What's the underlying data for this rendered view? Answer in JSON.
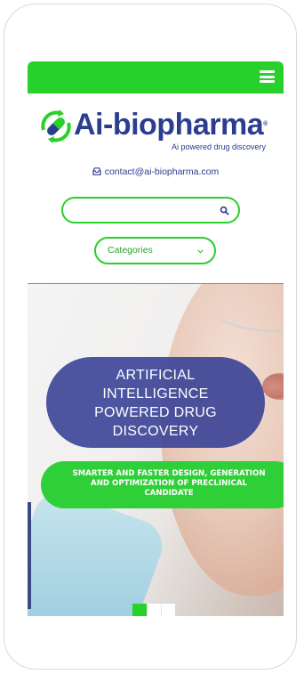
{
  "header": {
    "menu_icon": "hamburger-menu-icon",
    "accent_color": "#27d02a"
  },
  "brand": {
    "name_part1": "Ai-",
    "name_part2": "biopharma",
    "registered_mark": "®",
    "tagline": "Ai powered drug discovery",
    "brand_color": "#2b3d8f"
  },
  "contact": {
    "email": "contact@ai-biopharma.com",
    "icon": "email-tray-icon"
  },
  "search": {
    "value": "",
    "placeholder": "",
    "icon": "search-icon"
  },
  "categories": {
    "selected": "Categories",
    "icon": "chevron-down-icon"
  },
  "hero": {
    "title": "ARTIFICIAL\nINTELLIGENCE\nPOWERED DRUG\nDISCOVERY",
    "subtitle": "SMARTER AND FASTER DESIGN, GENERATION\nAND OPTIMIZATION OF PRECLINICAL\nCANDIDATE",
    "slides": 3,
    "active_slide": 1
  }
}
